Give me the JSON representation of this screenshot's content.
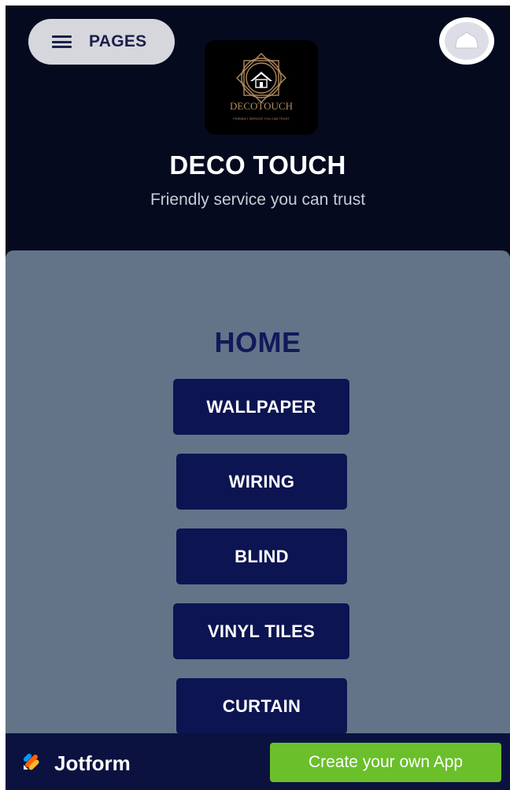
{
  "header": {
    "menu_label": "PAGES",
    "logo": {
      "brand": "DECOTOUCH",
      "tagline": "FRIENDLY SERVICE YOU CAN TRUST"
    },
    "title": "DECO TOUCH",
    "subtitle": "Friendly service you can trust"
  },
  "main": {
    "heading": "HOME",
    "buttons": [
      {
        "label": "WALLPAPER"
      },
      {
        "label": "WIRING"
      },
      {
        "label": "BLIND"
      },
      {
        "label": "VINYL TILES"
      },
      {
        "label": "CURTAIN"
      }
    ]
  },
  "footer": {
    "brand": "Jotform",
    "cta_label": "Create your own App"
  },
  "colors": {
    "header_bg": "#050a1f",
    "panel_bg": "#637489",
    "button_bg": "#0c1452",
    "heading_color": "#13195a",
    "cta_bg": "#6abf2a",
    "footer_bg": "#0b1240"
  },
  "icons": {
    "menu": "hamburger-icon",
    "avatar": "user-avatar-icon",
    "brand": "jotform-logo-icon"
  }
}
